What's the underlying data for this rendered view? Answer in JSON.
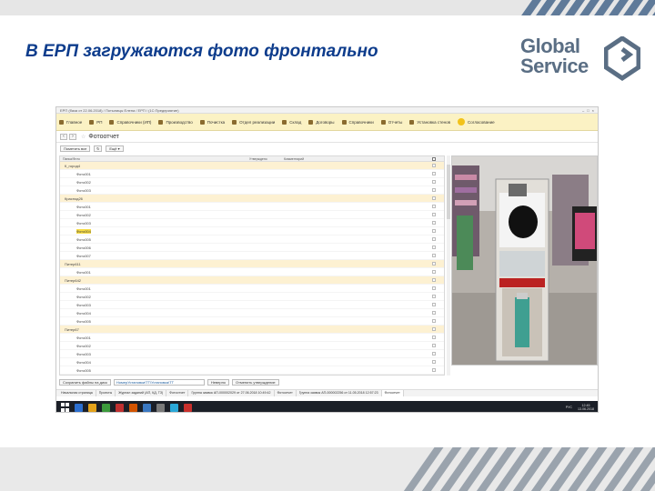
{
  "slide": {
    "title": "В ЕРП загружаются фото фронтально",
    "logo": {
      "line1": "Global",
      "line2": "Service"
    }
  },
  "app": {
    "window_title": "ЕРП (база от 22.06.2018) / Потылицы Елена / ЕРП / (1С:Предприятие)",
    "menu": [
      {
        "label": "Главное",
        "icon": "home-icon"
      },
      {
        "label": "РП",
        "icon": "crm-icon"
      },
      {
        "label": "Справочники (ИП)",
        "icon": "book-icon"
      },
      {
        "label": "Производство",
        "icon": "factory-icon"
      },
      {
        "label": "Почистка",
        "icon": "clean-icon"
      },
      {
        "label": "Отдел реализации",
        "icon": "wrench-icon"
      },
      {
        "label": "Склад",
        "icon": "warehouse-icon"
      },
      {
        "label": "Договоры",
        "icon": "contract-icon"
      },
      {
        "label": "Справочники",
        "icon": "book-icon"
      },
      {
        "label": "Отчеты",
        "icon": "report-icon"
      },
      {
        "label": "Установка стенов",
        "icon": "install-icon"
      },
      {
        "label": "Согласование",
        "icon": "approval-icon"
      }
    ],
    "form_title": "Фотоотчет",
    "toolbar": {
      "mark_all": "Пометить все",
      "more": "Ещё"
    },
    "tree_columns": {
      "name": "Папка/Фото",
      "approved": "Утверждено",
      "comment": "Комментарий"
    },
    "tree_rows": [
      {
        "label": "К_город4",
        "kind": "group"
      },
      {
        "label": "Фото001",
        "kind": "item"
      },
      {
        "label": "Фото002",
        "kind": "item"
      },
      {
        "label": "Фото003",
        "kind": "item"
      },
      {
        "label": "Краснод26",
        "kind": "group"
      },
      {
        "label": "Фото001",
        "kind": "item"
      },
      {
        "label": "Фото002",
        "kind": "item"
      },
      {
        "label": "Фото003",
        "kind": "item"
      },
      {
        "label": "Фото004",
        "kind": "item",
        "selected": true
      },
      {
        "label": "Фото005",
        "kind": "item"
      },
      {
        "label": "Фото006",
        "kind": "item"
      },
      {
        "label": "Фото007",
        "kind": "item"
      },
      {
        "label": "Питер611",
        "kind": "group"
      },
      {
        "label": "Фото001",
        "kind": "item"
      },
      {
        "label": "Питер642",
        "kind": "group"
      },
      {
        "label": "Фото001",
        "kind": "item"
      },
      {
        "label": "Фото002",
        "kind": "item"
      },
      {
        "label": "Фото003",
        "kind": "item"
      },
      {
        "label": "Фото004",
        "kind": "item"
      },
      {
        "label": "Фото005",
        "kind": "item"
      },
      {
        "label": "Питер67",
        "kind": "group"
      },
      {
        "label": "Фото001",
        "kind": "item"
      },
      {
        "label": "Фото002",
        "kind": "item"
      },
      {
        "label": "Фото003",
        "kind": "item"
      },
      {
        "label": "Фото004",
        "kind": "item"
      },
      {
        "label": "Фото005",
        "kind": "item"
      }
    ],
    "bottom": {
      "save_files": "Сохранить файлы на диск",
      "path_value": "НомерУстановки\\ТТ\\Установка\\ТТ",
      "disapprove": "Неверно",
      "change_approval": "Отменить утверждение"
    },
    "open_windows": [
      "Начальная страница",
      "Проекты",
      "Журнал заданий (АП, КД, ТЗ)",
      "Фотоотчет",
      "Группа заявок АП-000002029 от 27.06.2018 10:49:42",
      "Фотоотчет",
      "Группа заявок АП-000002256 от 11.05.2018 12:57:23",
      "Фотоотчет"
    ],
    "taskbar": {
      "time": "12:45",
      "date": "13.06.2018",
      "lang": "РУС"
    }
  },
  "colors": {
    "title_blue": "#0d3c8c",
    "menu_bg": "#fbf2c4",
    "group_row_bg": "#fdf1d2",
    "selection_yellow": "#f7dc44",
    "logo_gray": "#5a6e84"
  }
}
